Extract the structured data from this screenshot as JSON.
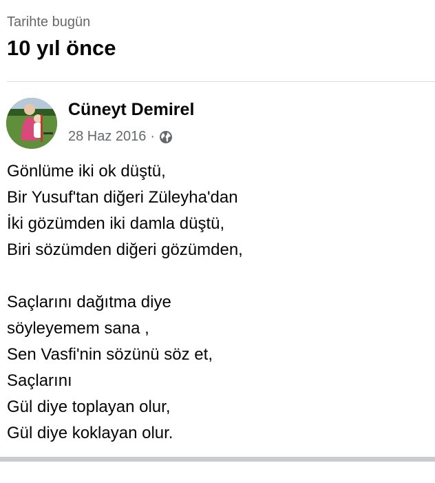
{
  "memory": {
    "subtitle": "Tarihte bugün",
    "title": "10 yıl önce"
  },
  "post": {
    "author": "Cüneyt Demirel",
    "date": "28 Haz 2016",
    "separator": "·",
    "privacy_icon": "globe-icon",
    "lines": [
      "Gönlüme iki ok düştü,",
      "Bir Yusuf'tan diğeri Züleyha'dan",
      "İki gözümden iki damla düştü,",
      "Biri sözümden diğeri gözümden,",
      "",
      "Saçlarını dağıtma diye",
      "söyleyemem sana ,",
      "Sen Vasfi'nin sözünü söz et,",
      "Saçlarını",
      "Gül diye toplayan olur,",
      "Gül diye koklayan olur."
    ]
  },
  "colors": {
    "secondary_text": "#65676b",
    "primary_text": "#050505",
    "divider": "#dadde1"
  }
}
